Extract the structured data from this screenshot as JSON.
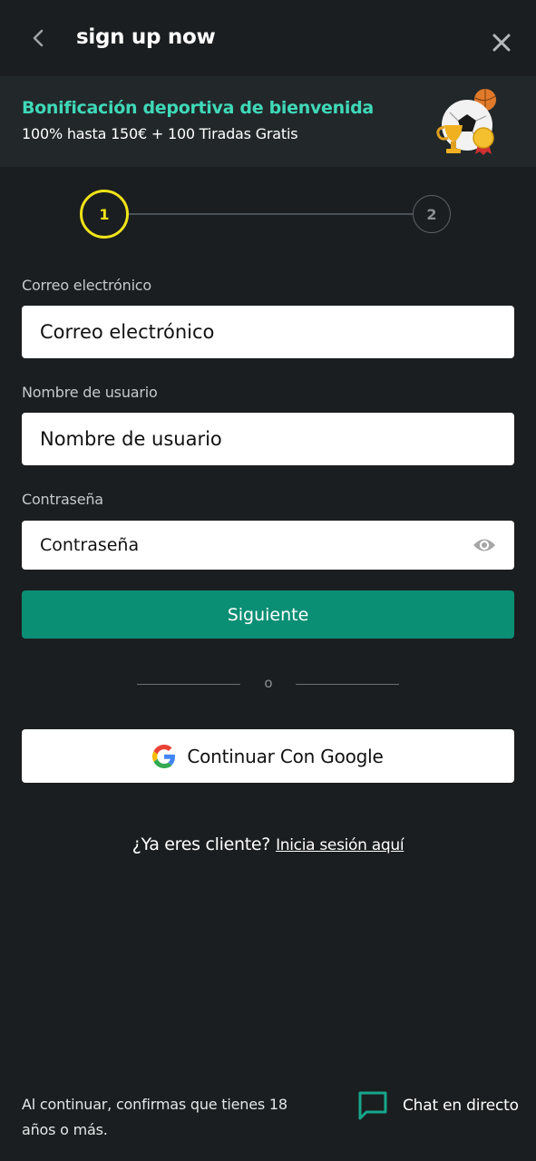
{
  "header": {
    "title": "sign up now",
    "back_icon": "chevron-left-icon",
    "close_icon": "close-icon"
  },
  "promo": {
    "title": "Bonificación deportiva de bienvenida",
    "subtitle": "100% hasta 150€ + 100 Tiradas Gratis",
    "image": "sports-trophy-football-illustration",
    "title_color": "#3fd9b8"
  },
  "stepper": {
    "steps": [
      {
        "label": "1",
        "state": "active",
        "color": "#f0e319"
      },
      {
        "label": "2",
        "state": "inactive"
      }
    ]
  },
  "form": {
    "email": {
      "label": "Correo electrónico",
      "placeholder": "Correo electrónico",
      "value": ""
    },
    "username": {
      "label": "Nombre de usuario",
      "placeholder": "Nombre de usuario",
      "value": ""
    },
    "password": {
      "label": "Contraseña",
      "placeholder": "Contraseña",
      "value": "",
      "toggle_icon": "eye-icon"
    },
    "next_label": "Siguiente",
    "next_color": "#0b8f74"
  },
  "divider": {
    "label": "o"
  },
  "google": {
    "label": "Continuar Con Google",
    "icon": "google-g-icon"
  },
  "login": {
    "question": "¿Ya eres cliente?",
    "link": "Inicia sesión aquí"
  },
  "footer": {
    "note": "Al continuar, confirmas que tienes 18 años o más.",
    "chat_label": "Chat en directo",
    "chat_icon": "chat-bubble-icon",
    "chat_color": "#17a58a"
  }
}
